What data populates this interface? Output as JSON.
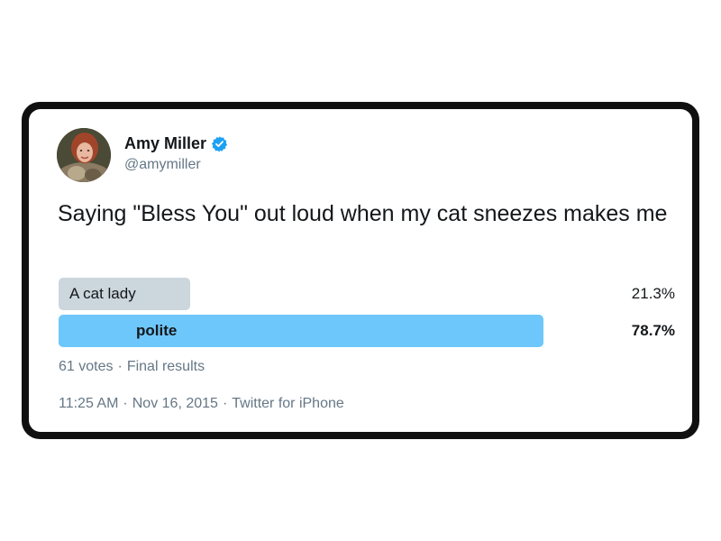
{
  "author": {
    "display_name": "Amy Miller",
    "handle": "@amymiller",
    "verified": true
  },
  "tweet": {
    "text": "Saying \"Bless You\" out loud when my cat sneezes makes me"
  },
  "poll": {
    "options": [
      {
        "label": "A cat lady",
        "percent_text": "21.3%",
        "fraction": 0.213,
        "winner": false
      },
      {
        "label": "polite",
        "percent_text": "78.7%",
        "fraction": 0.787,
        "winner": true
      }
    ],
    "votes_text": "61 votes",
    "status_text": "Final results"
  },
  "meta": {
    "time": "11:25 AM",
    "date": "Nov 16, 2015",
    "source": "Twitter for iPhone",
    "separator": "·"
  },
  "colors": {
    "verified_badge": "#1da1f2",
    "winner_bar": "#6ec7fb",
    "loser_bar": "#ccd6dd",
    "secondary_text": "#657786"
  }
}
